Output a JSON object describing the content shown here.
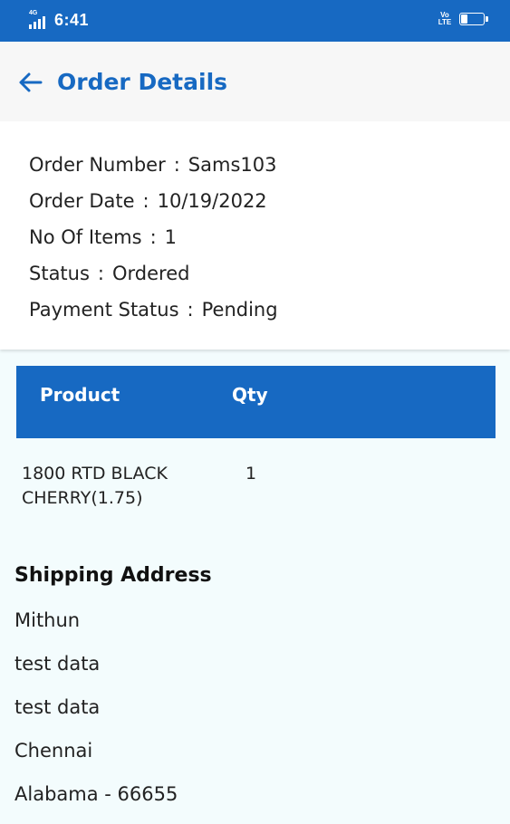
{
  "status_bar": {
    "network_label": "4G",
    "time": "6:41",
    "volte_label": "Vo LTE",
    "battery_level": "25",
    "battery_fraction": 0.25
  },
  "header": {
    "back_icon": "arrow-left-icon",
    "title": "Order Details",
    "accent_color": "#1769c2"
  },
  "summary": {
    "separator": ":",
    "rows": [
      {
        "label": "Order Number",
        "value": "Sams103"
      },
      {
        "label": "Order Date",
        "value": "10/19/2022"
      },
      {
        "label": "No Of Items",
        "value": "1"
      },
      {
        "label": "Status",
        "value": "Ordered"
      },
      {
        "label": "Payment Status",
        "value": "Pending"
      }
    ]
  },
  "products": {
    "columns": {
      "product": "Product",
      "qty": "Qty"
    },
    "rows": [
      {
        "product": "1800 RTD BLACK CHERRY(1.75)",
        "qty": "1"
      }
    ]
  },
  "shipping": {
    "title": "Shipping Address",
    "lines": [
      "Mithun",
      "test data",
      "test data",
      "Chennai",
      "Alabama - 66655"
    ]
  }
}
